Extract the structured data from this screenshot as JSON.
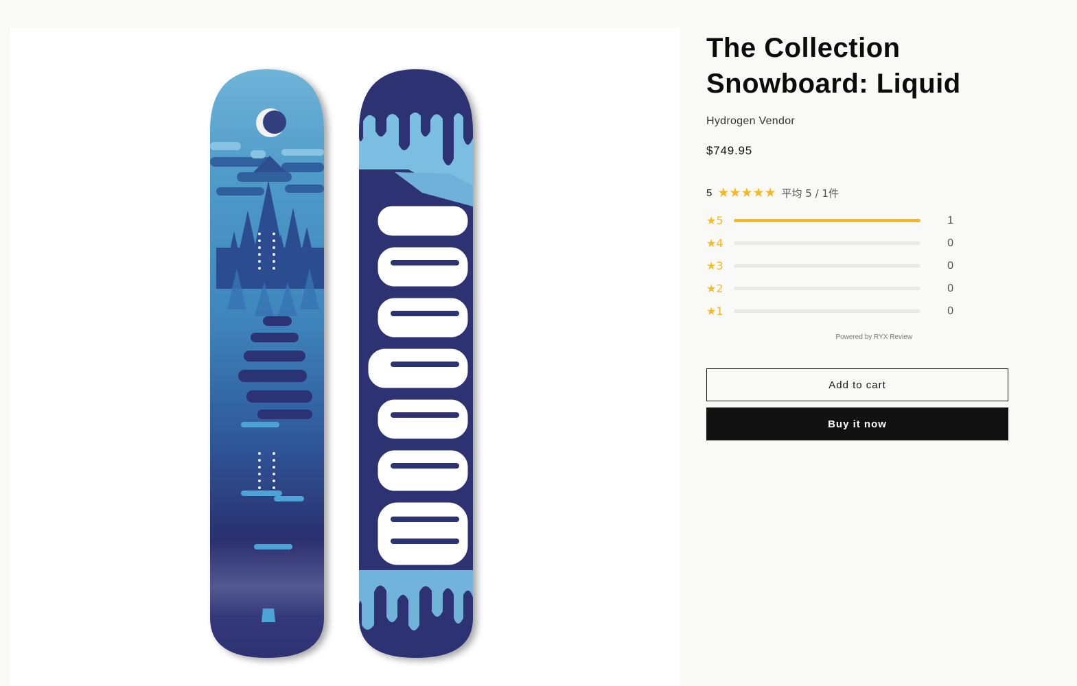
{
  "product": {
    "title_line1": "The Collection",
    "title_line2": "Snowboard: Liquid",
    "vendor": "Hydrogen Vendor",
    "price": "$749.95",
    "image_alt": "Liquid snowboard top and bottom view"
  },
  "reviews": {
    "average": "5",
    "stars": "★★★★★",
    "summary": "平均 5 / 1件",
    "rows": [
      {
        "label": "★5",
        "count": "1",
        "fraction": 1.0
      },
      {
        "label": "★4",
        "count": "0",
        "fraction": 0
      },
      {
        "label": "★3",
        "count": "0",
        "fraction": 0
      },
      {
        "label": "★2",
        "count": "0",
        "fraction": 0
      },
      {
        "label": "★1",
        "count": "0",
        "fraction": 0
      }
    ],
    "powered_by": "Powered by RYX Review"
  },
  "actions": {
    "add_to_cart": "Add to cart",
    "buy_now": "Buy it now"
  },
  "colors": {
    "star": "#f5b921",
    "button_dark": "#121212",
    "board_light": "#4f9bc9",
    "board_dark": "#2b2f6e"
  }
}
